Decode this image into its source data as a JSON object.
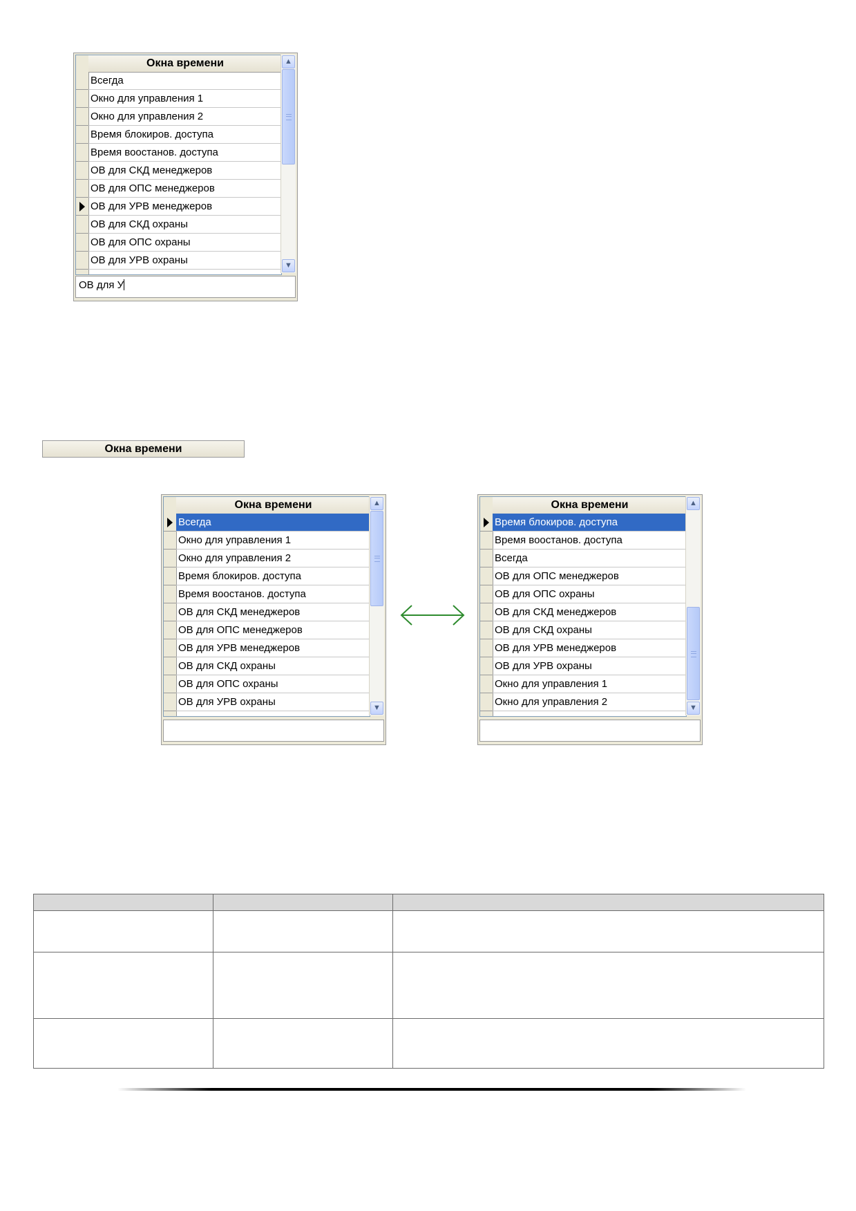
{
  "grid_header": "Окна времени",
  "grid1": {
    "rows": [
      "Всегда",
      "Окно для управления 1",
      "Окно для управления 2",
      "Время блокиров. доступа",
      "Время воостанов. доступа",
      "ОВ для СКД менеджеров",
      "ОВ для ОПС менеджеров",
      "ОВ для УРВ менеджеров",
      "ОВ для СКД охраны",
      "ОВ для ОПС охраны",
      "ОВ для УРВ охраны"
    ],
    "filter_value": "ОВ для У"
  },
  "lone_header": "Окна времени",
  "grid2": {
    "rows": [
      "Всегда",
      "Окно для управления 1",
      "Окно для управления 2",
      "Время блокиров. доступа",
      "Время воостанов. доступа",
      "ОВ для СКД менеджеров",
      "ОВ для ОПС менеджеров",
      "ОВ для УРВ менеджеров",
      "ОВ для СКД охраны",
      "ОВ для ОПС охраны",
      "ОВ для УРВ охраны"
    ],
    "filter_value": ""
  },
  "grid3": {
    "rows": [
      "Время блокиров. доступа",
      "Время воостанов. доступа",
      "Всегда",
      "ОВ для ОПС менеджеров",
      "ОВ для ОПС охраны",
      "ОВ для СКД менеджеров",
      "ОВ для СКД охраны",
      "ОВ для УРВ менеджеров",
      "ОВ для УРВ охраны",
      "Окно для управления 1",
      "Окно для управления 2"
    ],
    "filter_value": ""
  },
  "colors": {
    "selection": "#316ac5",
    "arrow": "#2e8b2e",
    "chrome": "#ece9d8"
  }
}
